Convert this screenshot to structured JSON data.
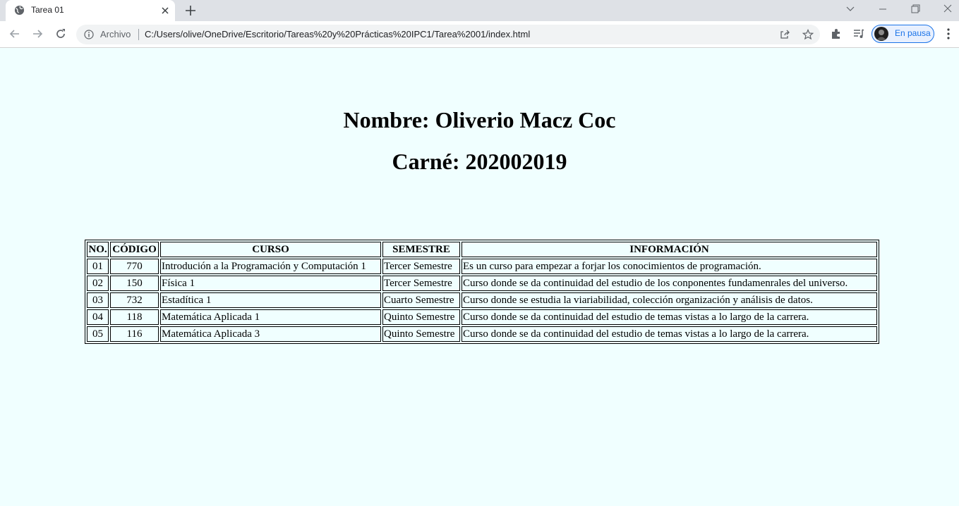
{
  "browser": {
    "tab_title": "Tarea 01",
    "origin_label": "Archivo",
    "url": "C:/Users/olive/OneDrive/Escritorio/Tareas%20y%20Prácticas%20IPC1/Tarea%2001/index.html",
    "profile_label": "En pausa"
  },
  "page": {
    "name_heading": "Nombre: Oliverio Macz Coc",
    "carne_heading": "Carné: 202002019",
    "table": {
      "headers": [
        "NO.",
        "CÓDIGO",
        "CURSO",
        "SEMESTRE",
        "INFORMACIÓN"
      ],
      "rows": [
        [
          "01",
          "770",
          "Introdución a la Programación y Computación 1",
          "Tercer Semestre",
          "Es un curso para empezar a forjar los conocimientos de programación."
        ],
        [
          "02",
          "150",
          "Física 1",
          "Tercer Semestre",
          "Curso donde se da continuidad del estudio de los conponentes fundamenrales del universo."
        ],
        [
          "03",
          "732",
          "Estadítica 1",
          "Cuarto Semestre",
          "Curso donde se estudia la viariabilidad, colección organización y análisis de datos."
        ],
        [
          "04",
          "118",
          "Matemática Aplicada 1",
          "Quinto Semestre",
          "Curso donde se da continuidad del estudio de temas vistas a lo largo de la carrera."
        ],
        [
          "05",
          "116",
          "Matemática Aplicada 3",
          "Quinto Semestre",
          "Curso donde se da continuidad del estudio de temas vistas a lo largo de la carrera."
        ]
      ]
    }
  }
}
